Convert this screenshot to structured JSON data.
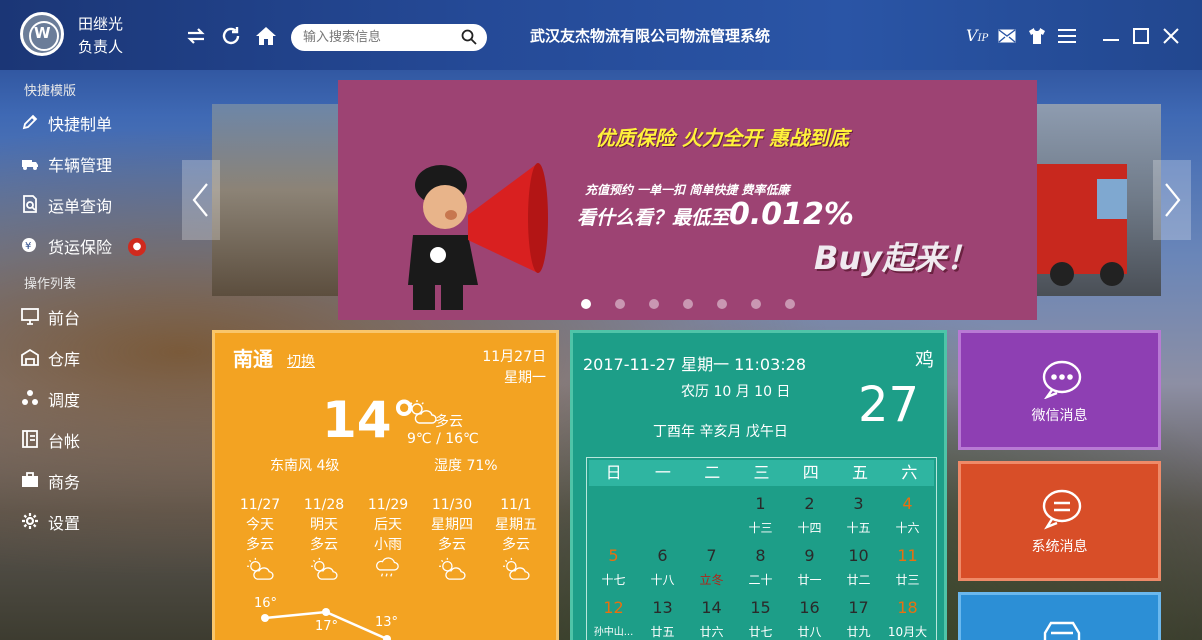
{
  "user": {
    "name": "田继光",
    "role": "负责人"
  },
  "search": {
    "placeholder": "输入搜索信息"
  },
  "app_title": "武汉友杰物流有限公司物流管理系统",
  "window_controls": [
    "vip-icon",
    "mail-icon",
    "shirt-icon",
    "menu-icon",
    "minimize-icon",
    "maximize-icon",
    "close-icon"
  ],
  "sidebar": {
    "section_quick": "快捷模版",
    "quick_items": [
      {
        "label": "快捷制单",
        "icon": "edit-icon"
      },
      {
        "label": "车辆管理",
        "icon": "vehicle-icon"
      },
      {
        "label": "运单查询",
        "icon": "document-search-icon"
      },
      {
        "label": "货运保险",
        "icon": "insurance-icon",
        "badge": true
      }
    ],
    "section_ops": "操作列表",
    "ops_items": [
      {
        "label": "前台",
        "icon": "monitor-icon"
      },
      {
        "label": "仓库",
        "icon": "warehouse-icon"
      },
      {
        "label": "调度",
        "icon": "dispatch-icon"
      },
      {
        "label": "台帐",
        "icon": "ledger-icon"
      },
      {
        "label": "商务",
        "icon": "briefcase-icon"
      },
      {
        "label": "设置",
        "icon": "gear-icon"
      }
    ]
  },
  "banner": {
    "headline": "优质保险  火力全开  惠战到底",
    "tags": "充值预约  一单一扣  简单快捷  费率低廉",
    "main_prefix": "看什么看？最低至",
    "main_pct": "0.012%",
    "buy": "Buy起来！",
    "slides": 7,
    "active_slide": 0,
    "background": "#9d4373"
  },
  "weather": {
    "city": "南通",
    "switch": "切换",
    "date": "11月27日",
    "weekday": "星期一",
    "temp": "14°",
    "condition": "多云",
    "range": "9℃ / 16℃",
    "wind": "东南风 4级",
    "humidity": "湿度 71%",
    "forecast": [
      {
        "date": "11/27",
        "day": "今天",
        "cond": "多云",
        "icon": "partly-cloudy-icon"
      },
      {
        "date": "11/28",
        "day": "明天",
        "cond": "多云",
        "icon": "partly-cloudy-icon"
      },
      {
        "date": "11/29",
        "day": "后天",
        "cond": "小雨",
        "icon": "rain-icon"
      },
      {
        "date": "11/30",
        "day": "星期四",
        "cond": "多云",
        "icon": "partly-cloudy-icon"
      },
      {
        "date": "11/1",
        "day": "星期五",
        "cond": "多云",
        "icon": "partly-cloudy-icon"
      }
    ],
    "temps": [
      "16°",
      "17°",
      "13°"
    ],
    "accent": "#f3a322"
  },
  "calendar": {
    "datetime": "2017-11-27 星期一   11:03:28",
    "zodiac": "鸡",
    "lunar": "农历 10 月 10 日",
    "day": "27",
    "ganzhi": "丁酉年 辛亥月 戊午日",
    "weekdays": [
      "日",
      "一",
      "二",
      "三",
      "四",
      "五",
      "六"
    ],
    "rows": [
      [
        null,
        null,
        null,
        {
          "d": "1",
          "l": "十三"
        },
        {
          "d": "2",
          "l": "十四"
        },
        {
          "d": "3",
          "l": "十五"
        },
        {
          "d": "4",
          "l": "十六"
        }
      ],
      [
        {
          "d": "5",
          "l": "十七"
        },
        {
          "d": "6",
          "l": "十八"
        },
        {
          "d": "7",
          "l": "立冬",
          "term": true
        },
        {
          "d": "8",
          "l": "二十"
        },
        {
          "d": "9",
          "l": "廿一"
        },
        {
          "d": "10",
          "l": "廿二"
        },
        {
          "d": "11",
          "l": "廿三"
        }
      ],
      [
        {
          "d": "12",
          "l": "孙中山..."
        },
        {
          "d": "13",
          "l": "廿五"
        },
        {
          "d": "14",
          "l": "廿六"
        },
        {
          "d": "15",
          "l": "廿七"
        },
        {
          "d": "16",
          "l": "廿八"
        },
        {
          "d": "17",
          "l": "廿九"
        },
        {
          "d": "18",
          "l": "10月大"
        }
      ]
    ],
    "accent": "#1d9e88"
  },
  "tiles": [
    {
      "label": "微信消息",
      "icon": "chat-bubble-icon",
      "color": "#8e3fb3",
      "border": "#b87ad4"
    },
    {
      "label": "系统消息",
      "icon": "message-icon",
      "color": "#d84e28",
      "border": "#ef8a68"
    },
    {
      "label": "",
      "icon": "car-icon",
      "color": "#2c8fd6",
      "border": "#6ab8ee"
    }
  ]
}
